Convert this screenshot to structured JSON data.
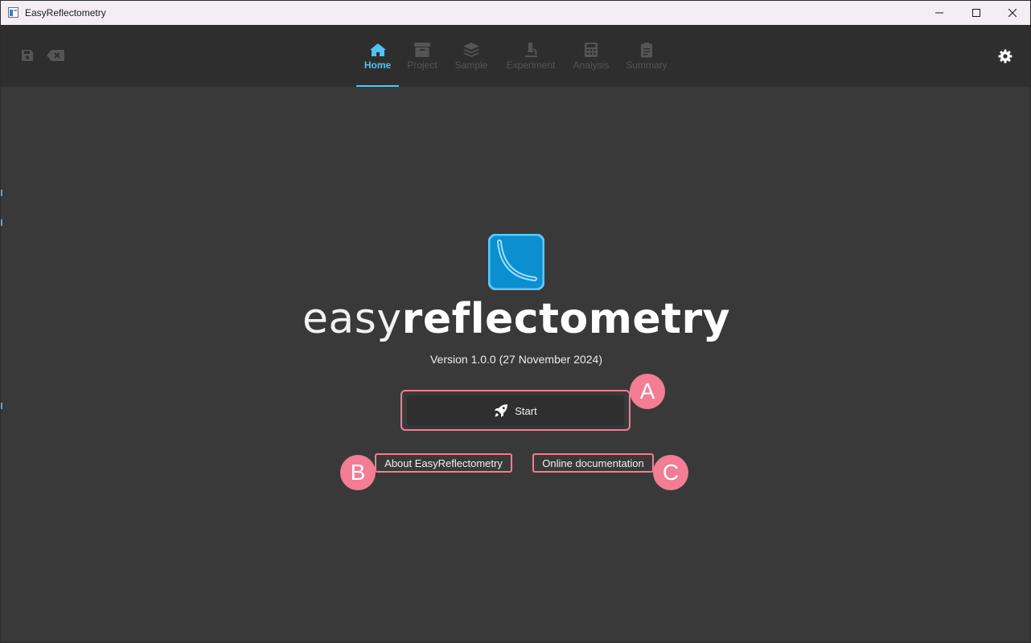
{
  "window": {
    "title": "EasyReflectometry"
  },
  "toolbar": {
    "tabs": [
      {
        "label": "Home",
        "icon": "home-icon",
        "active": true
      },
      {
        "label": "Project",
        "icon": "archive-icon",
        "active": false
      },
      {
        "label": "Sample",
        "icon": "layers-icon",
        "active": false
      },
      {
        "label": "Experiment",
        "icon": "microscope-icon",
        "active": false
      },
      {
        "label": "Analysis",
        "icon": "calculator-icon",
        "active": false
      },
      {
        "label": "Summary",
        "icon": "clipboard-icon",
        "active": false
      }
    ]
  },
  "main": {
    "brand_light": "easy",
    "brand_bold": "reflectometry",
    "version": "Version 1.0.0 (27 November 2024)",
    "start_label": "Start",
    "about_link": "About EasyReflectometry",
    "docs_link": "Online documentation"
  },
  "annotations": {
    "a": "A",
    "b": "B",
    "c": "C"
  },
  "colors": {
    "accent": "#4fc3f7",
    "annotation": "#f27d95",
    "background": "#393939",
    "toolbar": "#2e2e2e"
  }
}
